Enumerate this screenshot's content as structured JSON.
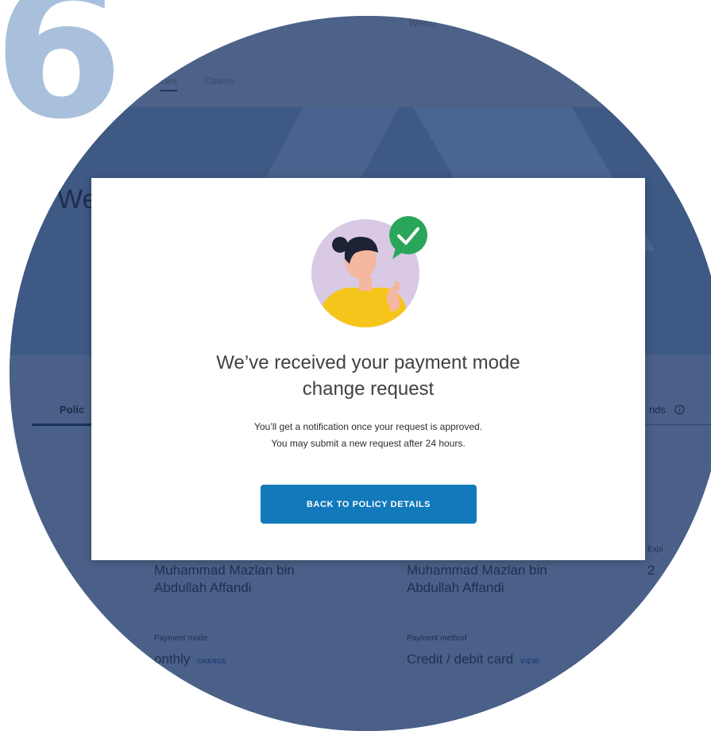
{
  "step_number": "6",
  "page": {
    "header": {
      "welcome_text": "Welco",
      "nav": {
        "policies_label": "cies",
        "claims_label": "Claims"
      }
    },
    "hero": {
      "greeting": "We"
    },
    "tabs": {
      "policy_label": "Polic",
      "funds_label": "nds"
    },
    "fields": {
      "policy_owner_name": [
        "Muhammad Mazlan bin",
        "Abdullah Affandi"
      ],
      "insured_name": [
        "Muhammad Mazlan bin",
        "Abdullah Affandi"
      ],
      "expiry_label": "Expi",
      "expiry_value": "2",
      "payment_mode": {
        "label": "Payment mode",
        "value": "onthly",
        "link": "CHANGE"
      },
      "payment_method": {
        "label": "Payment method",
        "value": "Credit / debit card",
        "link": "VIEW/"
      }
    }
  },
  "modal": {
    "title": [
      "We’ve received your payment mode",
      "change request"
    ],
    "message": [
      "You’ll get a notification once your request is approved.",
      "You may submit a new request after 24 hours."
    ],
    "button_label": "BACK TO POLICY DETAILS",
    "illustration": "person-thumbs-up-with-check-icon"
  },
  "colors": {
    "overlay_blue": "#4a6088",
    "step_number": "#a8c0dc",
    "primary_button": "#1279bb",
    "check_badge": "#2aa65a",
    "shirt_yellow": "#f6c51b",
    "illustration_circle": "#d9c9e5"
  }
}
